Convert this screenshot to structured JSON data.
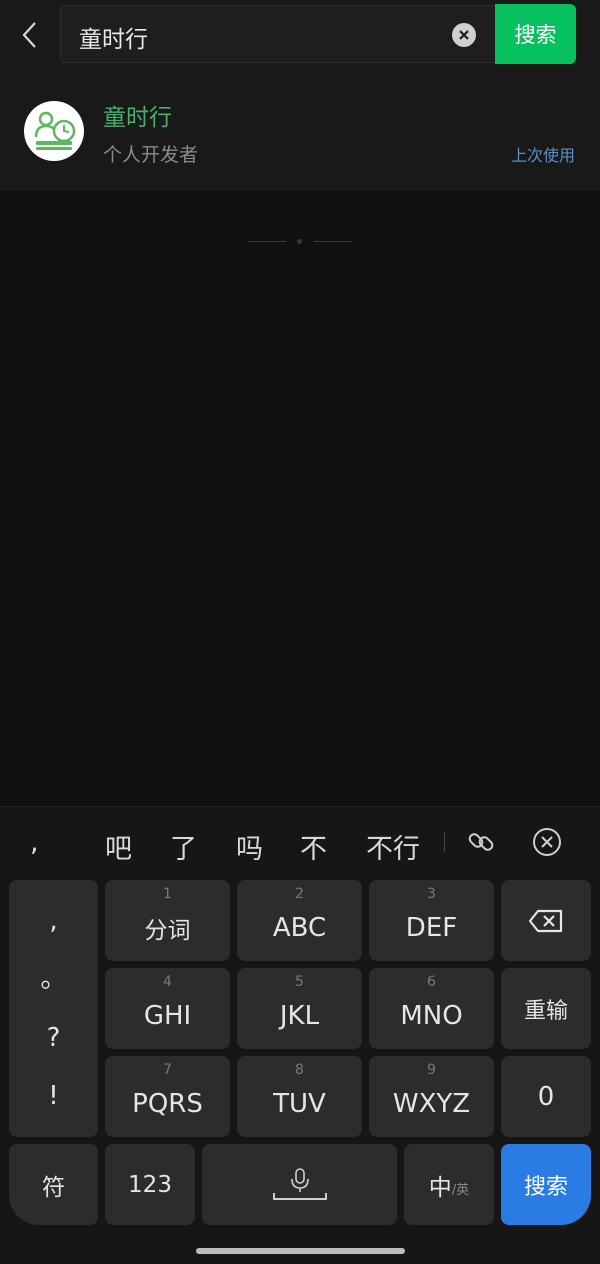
{
  "search": {
    "query": "童时行",
    "button_label": "搜索"
  },
  "result": {
    "name": "童时行",
    "subtitle": "个人开发者",
    "badge": "上次使用"
  },
  "candidates": [
    ",",
    "吧",
    "了",
    "吗",
    "不",
    "不行"
  ],
  "keyboard": {
    "punctuation": [
      ",",
      "。",
      "?",
      "!"
    ],
    "keys": [
      {
        "num": "1",
        "label": "分词"
      },
      {
        "num": "2",
        "label": "ABC"
      },
      {
        "num": "3",
        "label": "DEF"
      },
      {
        "num": "4",
        "label": "GHI"
      },
      {
        "num": "5",
        "label": "JKL"
      },
      {
        "num": "6",
        "label": "MNO"
      },
      {
        "num": "7",
        "label": "PQRS"
      },
      {
        "num": "8",
        "label": "TUV"
      },
      {
        "num": "9",
        "label": "WXYZ"
      }
    ],
    "retype": "重输",
    "zero": "0",
    "symbols": "符",
    "numbers": "123",
    "lang_main": "中",
    "lang_alt": "/英",
    "search": "搜索"
  },
  "colors": {
    "accent_green": "#07c160",
    "name_green": "#4cae6b",
    "link_blue": "#5b8fc9",
    "search_key_blue": "#2a7be4"
  }
}
